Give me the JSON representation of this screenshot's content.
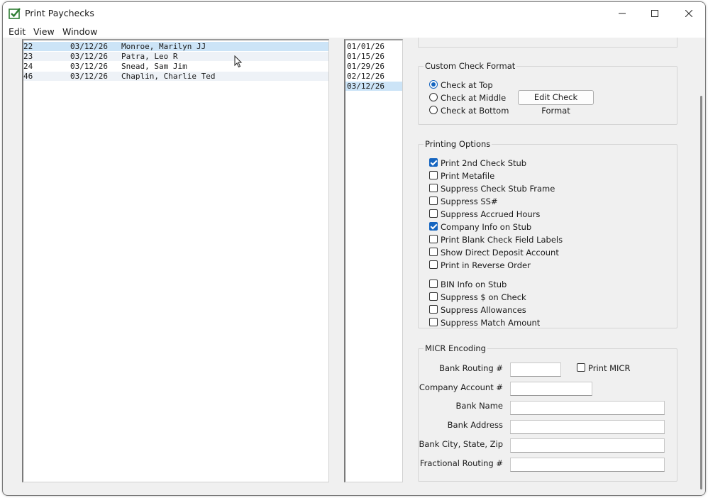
{
  "window": {
    "title": "Print Paychecks"
  },
  "menu": [
    "Edit",
    "View",
    "Window"
  ],
  "employees": [
    {
      "id": "22",
      "date": "03/12/26",
      "name": "Monroe, Marilyn JJ",
      "selected": true
    },
    {
      "id": "23",
      "date": "03/12/26",
      "name": "Patra, Leo R",
      "selected": false
    },
    {
      "id": "24",
      "date": "03/12/26",
      "name": "Snead, Sam Jim",
      "selected": false
    },
    {
      "id": "46",
      "date": "03/12/26",
      "name": "Chaplin, Charlie Ted",
      "selected": false
    }
  ],
  "pay_dates": [
    {
      "date": "01/01/26",
      "selected": false
    },
    {
      "date": "01/15/26",
      "selected": false
    },
    {
      "date": "01/29/26",
      "selected": false
    },
    {
      "date": "02/12/26",
      "selected": false
    },
    {
      "date": "03/12/26",
      "selected": true
    }
  ],
  "custom_check_format": {
    "title": "Custom Check Format",
    "options": [
      {
        "label": "Check at Top",
        "selected": true
      },
      {
        "label": "Check at Middle",
        "selected": false
      },
      {
        "label": "Check at Bottom",
        "selected": false
      }
    ],
    "edit_button": "Edit Check Format"
  },
  "printing_options": {
    "title": "Printing Options",
    "items": [
      {
        "label": "Print 2nd Check Stub",
        "checked": true
      },
      {
        "label": "Print Metafile",
        "checked": false
      },
      {
        "label": "Suppress Check Stub Frame",
        "checked": false
      },
      {
        "label": "Suppress SS#",
        "checked": false
      },
      {
        "label": "Suppress Accrued Hours",
        "checked": false
      },
      {
        "label": "Company Info on Stub",
        "checked": true
      },
      {
        "label": "Print Blank Check Field Labels",
        "checked": false
      },
      {
        "label": "Show Direct Deposit Account",
        "checked": false
      },
      {
        "label": "Print in Reverse Order",
        "checked": false
      },
      {
        "label": "BIN Info on Stub",
        "checked": false
      },
      {
        "label": "Suppress $ on Check",
        "checked": false
      },
      {
        "label": "Suppress Allowances",
        "checked": false
      },
      {
        "label": "Suppress Match Amount",
        "checked": false
      }
    ]
  },
  "micr": {
    "title": "MICR Encoding",
    "print_micr_label": "Print MICR",
    "print_micr_checked": false,
    "fields": [
      {
        "label": "Bank Routing #",
        "value": ""
      },
      {
        "label": "Company Account #",
        "value": ""
      },
      {
        "label": "Bank Name",
        "value": ""
      },
      {
        "label": "Bank Address",
        "value": ""
      },
      {
        "label": "Bank City, State, Zip",
        "value": ""
      },
      {
        "label": "Fractional Routing #",
        "value": ""
      }
    ]
  },
  "colors": {
    "selection": "#cce4f7",
    "accent": "#1565c0",
    "app_icon": "#2e7d32"
  }
}
